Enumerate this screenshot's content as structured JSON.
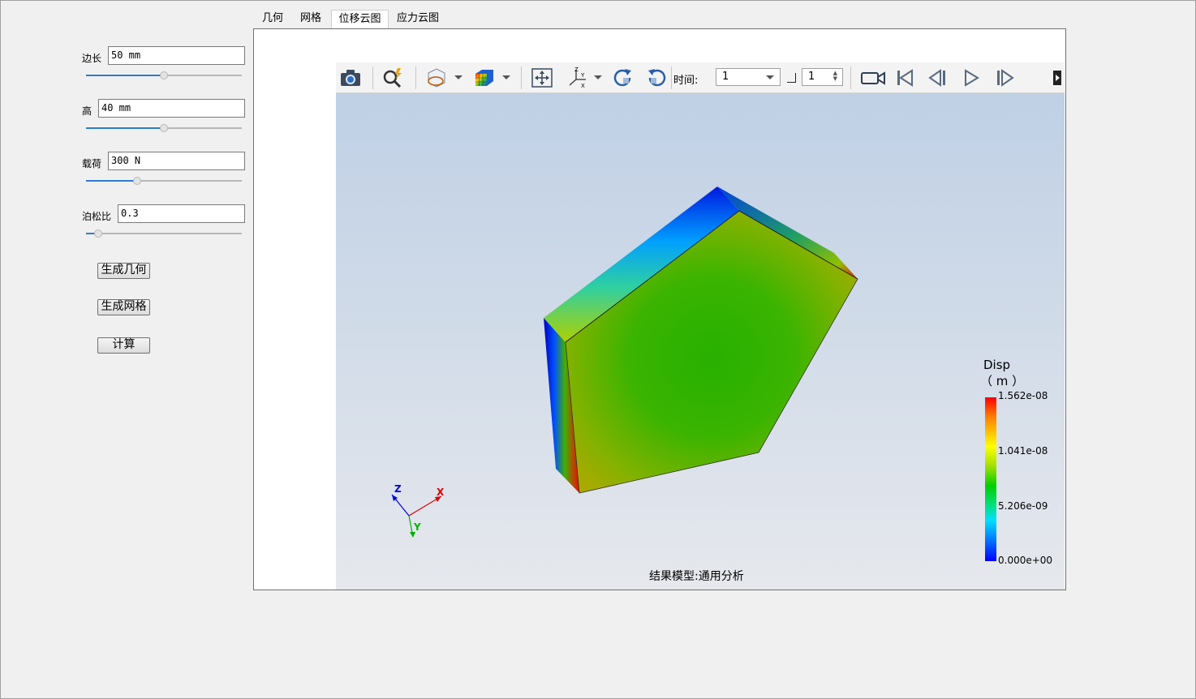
{
  "params": {
    "edge": {
      "label": "边长",
      "value": "50 mm",
      "slider": 0.5
    },
    "height": {
      "label": "高",
      "value": "40 mm",
      "slider": 0.5
    },
    "load": {
      "label": "载荷",
      "value": "300 N",
      "slider": 0.33
    },
    "poisson": {
      "label": "泊松比",
      "value": "0.3",
      "slider": 0.08
    }
  },
  "buttons": {
    "gen_geometry": "生成几何",
    "gen_mesh": "生成网格",
    "compute": "计算"
  },
  "tabs": [
    {
      "label": "几何",
      "active": false
    },
    {
      "label": "网格",
      "active": false
    },
    {
      "label": "位移云图",
      "active": true
    },
    {
      "label": "应力云图",
      "active": false
    }
  ],
  "toolbar": {
    "time_label": "时间:",
    "time_value": "1",
    "step_value": "1"
  },
  "legend": {
    "title": "Disp",
    "unit": "（ m ）",
    "ticks": [
      "1.562e-08",
      "1.041e-08",
      "5.206e-09",
      "0.000e+00"
    ]
  },
  "axes": {
    "x": "X",
    "y": "Y",
    "z": "Z"
  },
  "status": "结果模型:通用分析",
  "colors": {
    "accent": "#2f7ad1",
    "x_axis": "#e00000",
    "y_axis": "#00b000",
    "z_axis": "#0000e0"
  }
}
